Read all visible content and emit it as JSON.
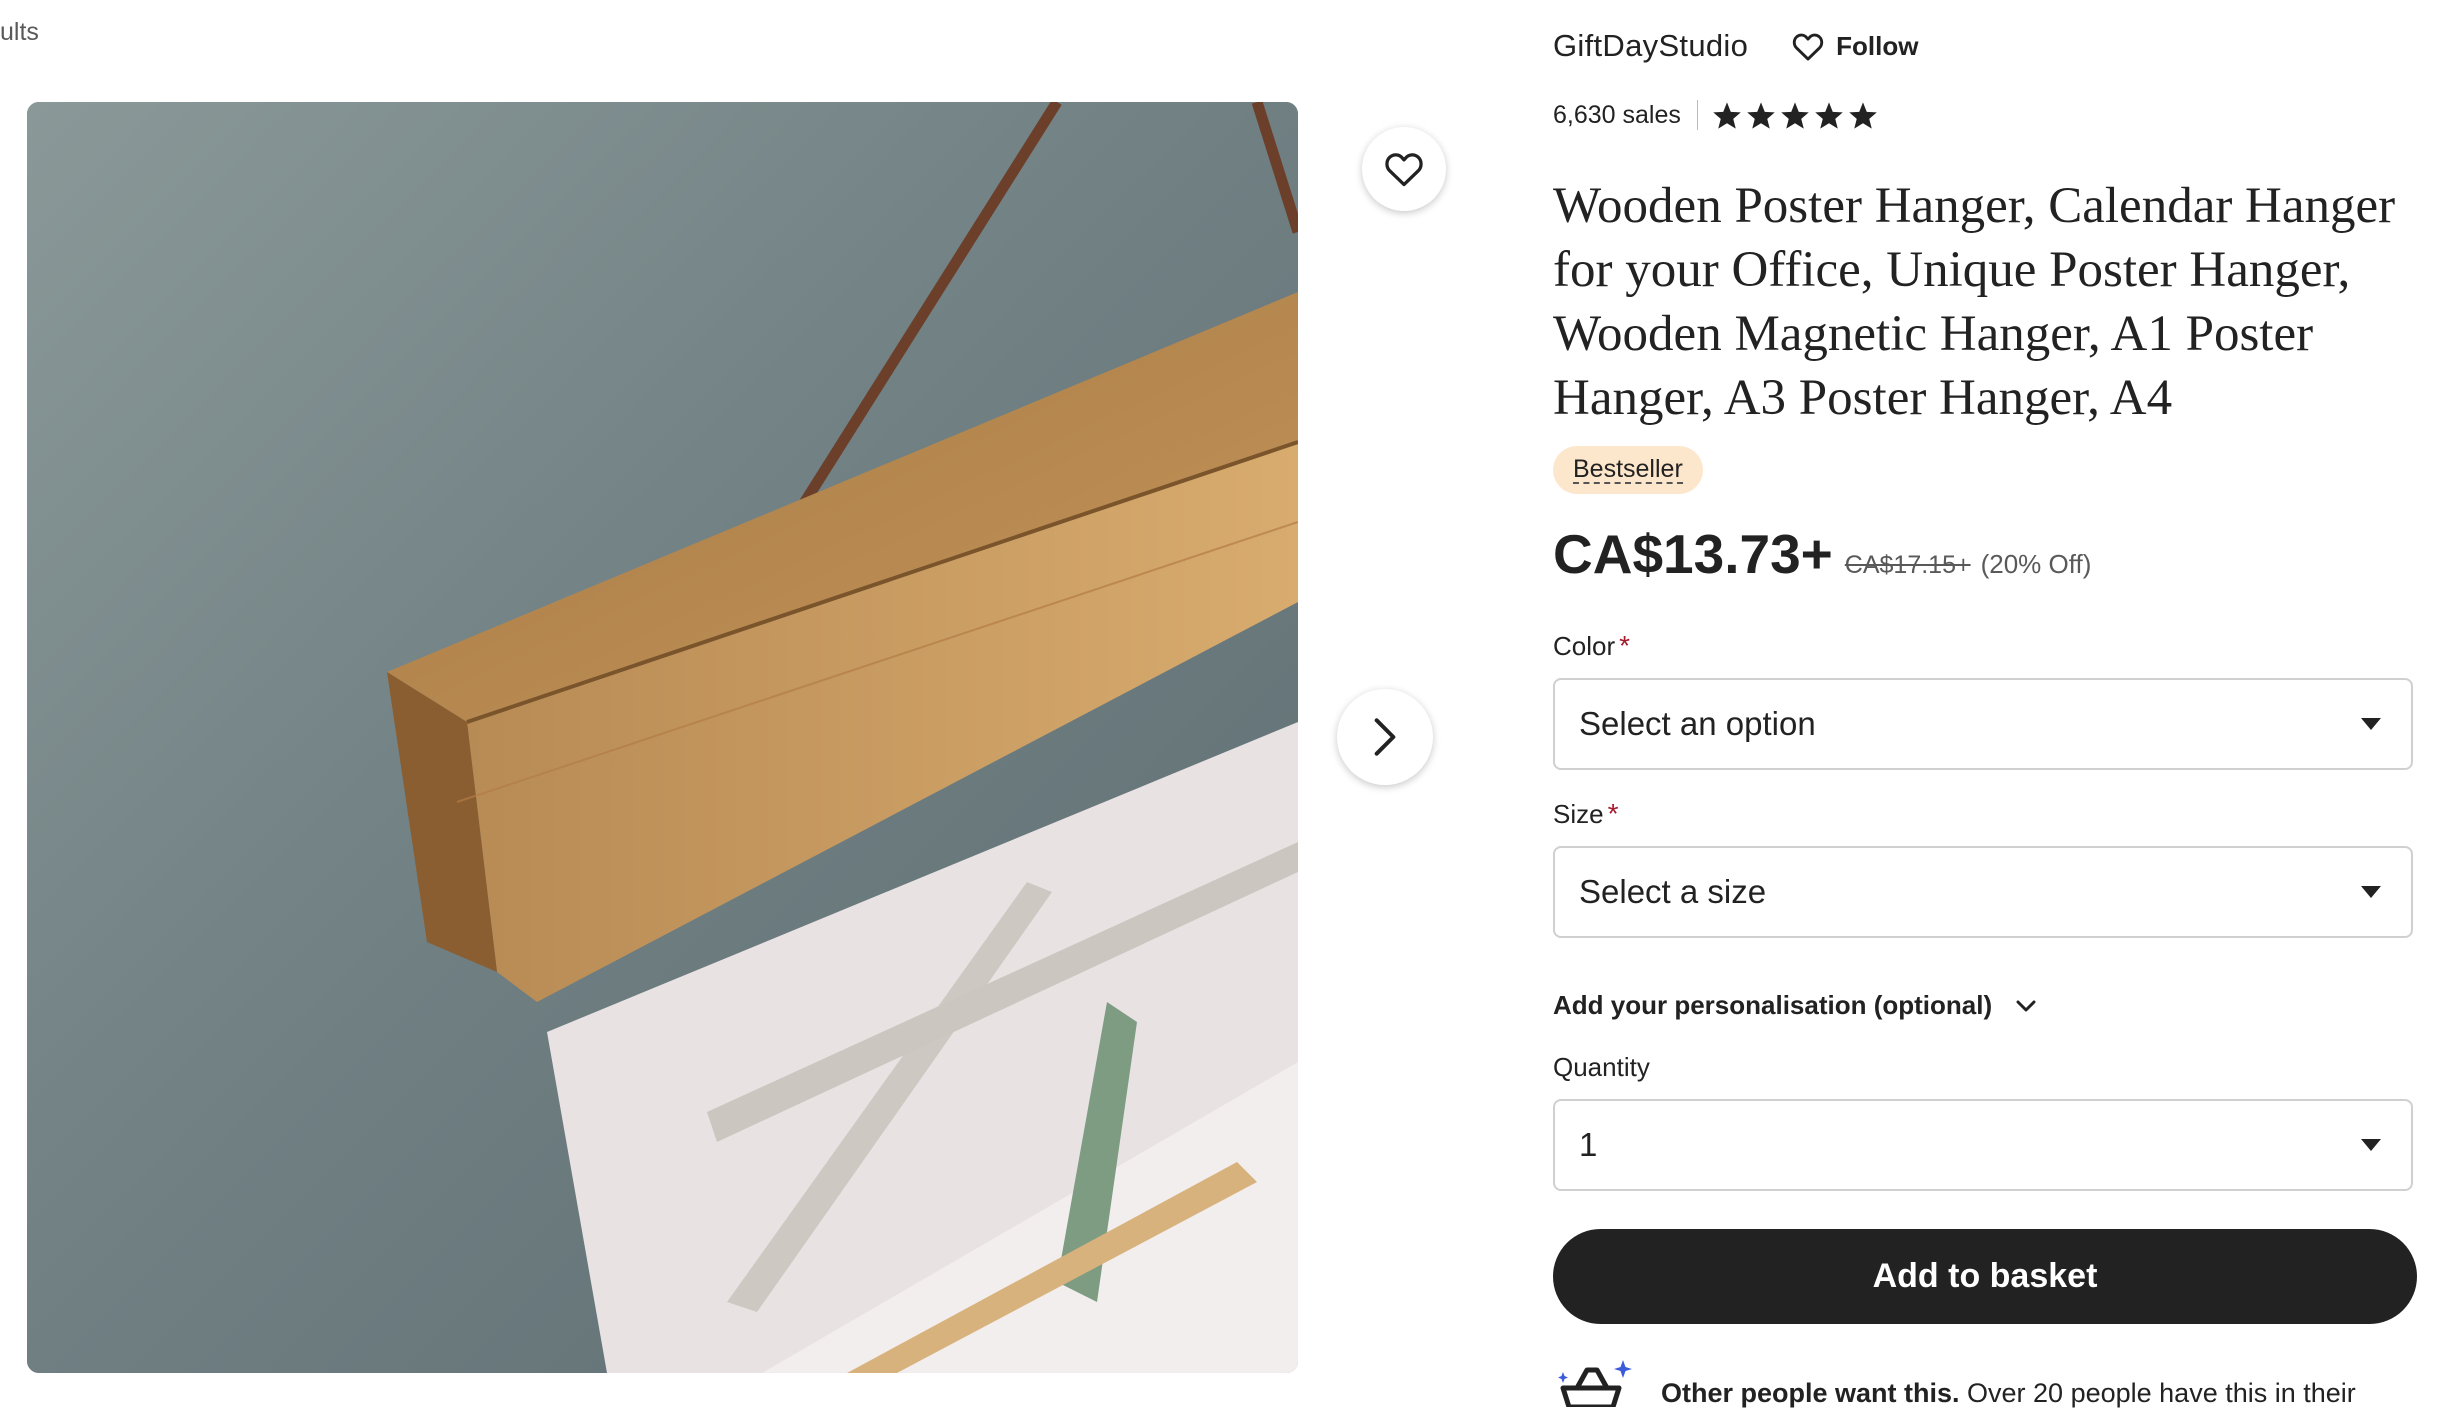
{
  "nav": {
    "back_text": "ults"
  },
  "shop": {
    "name": "GiftDayStudio",
    "follow_label": "Follow",
    "sales": "6,630 sales",
    "rating_stars": 5
  },
  "product": {
    "title": "Wooden Poster Hanger, Calendar Hanger for your Office, Unique Poster Hanger, Wooden Magnetic Hanger, A1 Poster Hanger, A3 Poster Hanger, A4",
    "badge": "Bestseller",
    "price": "CA$13.73+",
    "original_price": "CA$17.15+",
    "discount": "(20% Off)"
  },
  "options": {
    "color": {
      "label": "Color",
      "required_mark": "*",
      "value": "Select an option"
    },
    "size": {
      "label": "Size",
      "required_mark": "*",
      "value": "Select a size"
    },
    "personalisation_label": "Add your personalisation (optional)",
    "quantity": {
      "label": "Quantity",
      "value": "1"
    }
  },
  "cta": {
    "add_to_basket": "Add to basket"
  },
  "promo": {
    "bold": "Other people want this.",
    "text": " Over 20 people have this in their"
  },
  "icons": [
    "heart-icon",
    "chevron-right-icon",
    "star-icon",
    "chevron-down-icon",
    "basket-sparkle-icon"
  ],
  "colors": {
    "accent": "#222222",
    "badge_bg": "#fde7cc",
    "required": "#a61a2e"
  }
}
